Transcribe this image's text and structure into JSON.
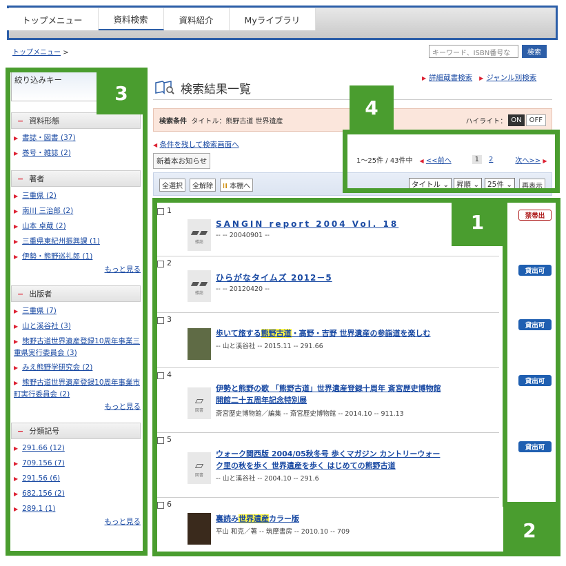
{
  "tabs": [
    "トップメニュー",
    "資料検索",
    "資料紹介",
    "Myライブラリ"
  ],
  "breadcrumb": "トップメニュー",
  "breadcrumb_sep": ">",
  "search": {
    "placeholder": "キーワード、ISBN番号な",
    "button": "検索"
  },
  "sidebar": {
    "title": "絞り込みキー",
    "sections": [
      {
        "title": "資料形態",
        "items": [
          "書誌・図書 (37)",
          "巻号・雑誌 (2)"
        ]
      },
      {
        "title": "著者",
        "items": [
          "三重県 (2)",
          "南川 三治郎 (2)",
          "山本 卓蔵 (2)",
          "三重県東紀州振興課 (1)",
          "伊勢・熊野巡礼郎 (1)"
        ],
        "more": "もっと見る"
      },
      {
        "title": "出版者",
        "items": [
          "三重県 (7)",
          "山と溪谷社 (3)",
          "熊野古道世界遺産登録10周年事業三重県実行委員会 (3)",
          "みえ熊野学研究会 (2)",
          "熊野古道世界遺産登録10周年事業市町実行委員会 (2)"
        ],
        "more": "もっと見る"
      },
      {
        "title": "分類記号",
        "items": [
          "291.66 (12)",
          "709.156 (7)",
          "291.56 (6)",
          "682.156 (2)",
          "289.1 (1)"
        ],
        "more": "もっと見る"
      }
    ]
  },
  "main": {
    "title": "検索結果一覧",
    "links": [
      "詳細蔵書検索",
      "ジャンル別検索"
    ],
    "condition": {
      "label": "検索条件",
      "text": "タイトル：熊野古道 世界遺産"
    },
    "highlight": {
      "label": "ハイライト：",
      "on": "ON",
      "off": "OFF"
    },
    "back": "条件を残して検索画面へ",
    "new_notice": "新着本お知らせ",
    "pager": {
      "range": "1〜25件 / 43件中",
      "prev": "<<前へ",
      "pages": [
        "1",
        "2"
      ],
      "next": "次へ>>"
    },
    "toolbar": {
      "select_all": "全選択",
      "deselect": "全解除",
      "shelf": "本棚へ",
      "sort_field": "タイトル",
      "sort_order": "昇順",
      "per_page": "25件",
      "redisplay": "再表示"
    }
  },
  "results": [
    {
      "no": "1",
      "title": "SANGIN report 2004 Vol. 18",
      "meta": "-- -- 20040901 --",
      "type": "雑誌",
      "badge": "禁帯出"
    },
    {
      "no": "2",
      "title": "ひらがなタイムズ 2012－5",
      "meta": "-- -- 20120420 --",
      "type": "雑誌",
      "badge": "貸出可"
    },
    {
      "no": "3",
      "title_parts": [
        "歩いて旅する",
        "熊野古道",
        "・高野・吉野 世界遺産の参詣道を楽しむ"
      ],
      "meta": "-- 山と溪谷社 -- 2015.11 -- 291.66",
      "badge": "貸出可"
    },
    {
      "no": "4",
      "title_lines": [
        "伊勢と熊野の歌 「熊野古道」世界遺産登録十周年 斎宮歴史博物館",
        "開館二十五周年記念特別展"
      ],
      "meta": "斎宮歴史博物館／編集 -- 斎宮歴史博物館 -- 2014.10 -- 911.13",
      "type": "図書",
      "badge": "貸出可"
    },
    {
      "no": "5",
      "title_lines": [
        "ウォーク関西版 2004/05秋冬号 歩くマガジン カントリーウォー",
        "ク里の秋を歩く 世界遺産を歩く はじめての熊野古道"
      ],
      "meta": "-- 山と溪谷社 -- 2004.10 -- 291.6",
      "type": "図書",
      "badge": "貸出可"
    },
    {
      "no": "6",
      "title_parts": [
        "裏読み",
        "世界遺産",
        "カラー版"
      ],
      "meta": "平山 和克／著 -- 筑摩書房 -- 2010.10 -- 709"
    }
  ],
  "callouts": [
    "1",
    "2",
    "3",
    "4"
  ],
  "colors": {
    "frame": "#2c5ea8",
    "callout": "#4a9d2f",
    "highlight": "#fdf349",
    "badge_ok": "#1f5fb1",
    "badge_ng": "#b02020"
  }
}
